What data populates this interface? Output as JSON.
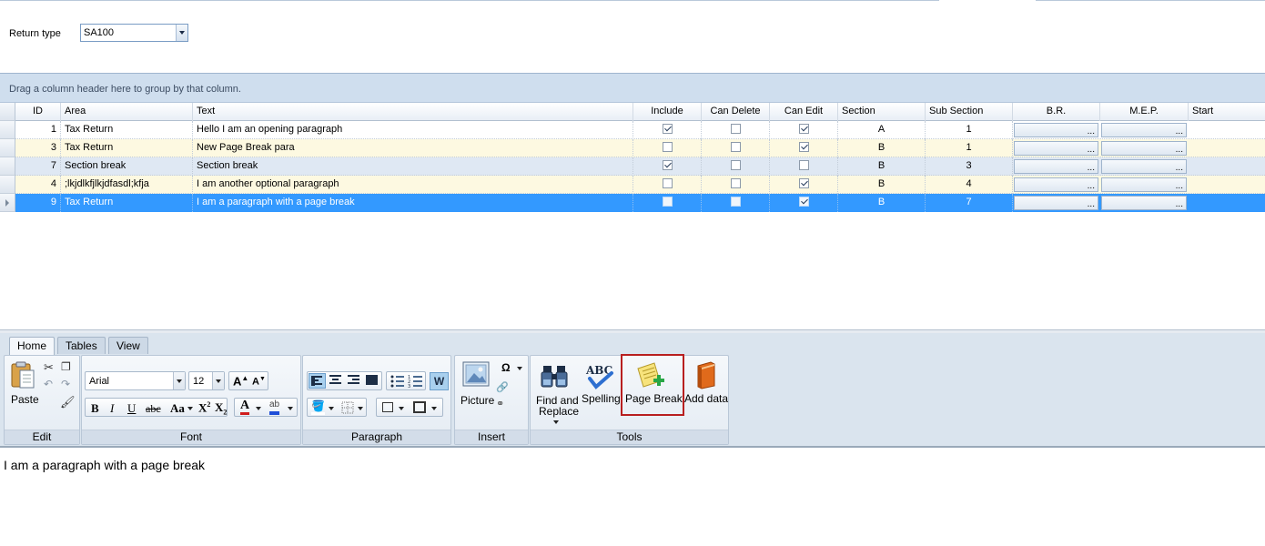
{
  "filter": {
    "label": "Return type",
    "value": "SA100"
  },
  "group_panel": {
    "text": "Drag a column header here to group by that column."
  },
  "grid": {
    "columns": [
      "ID",
      "Area",
      "Text",
      "Include",
      "Can Delete",
      "Can Edit",
      "Section",
      "Sub Section",
      "B.R.",
      "M.E.P.",
      "Start"
    ],
    "ellipsis": "...",
    "rows": [
      {
        "id": "1",
        "area": "Tax Return",
        "text": "Hello I am an opening paragraph",
        "include": true,
        "can_delete": false,
        "can_edit": true,
        "section": "A",
        "sub_section": "1"
      },
      {
        "id": "3",
        "area": "Tax Return",
        "text": "New Page Break para",
        "include": false,
        "can_delete": false,
        "can_edit": true,
        "section": "B",
        "sub_section": "1"
      },
      {
        "id": "7",
        "area": "Section break",
        "text": "Section break",
        "include": true,
        "can_delete": false,
        "can_edit": false,
        "section": "B",
        "sub_section": "3"
      },
      {
        "id": "4",
        "area": ";lkjdlkfjlkjdfasdl;kfja",
        "text": "I am another optional paragraph",
        "include": false,
        "can_delete": false,
        "can_edit": true,
        "section": "B",
        "sub_section": "4"
      },
      {
        "id": "9",
        "area": "Tax Return",
        "text": "I am a paragraph with a page break",
        "include": false,
        "can_delete": false,
        "can_edit": true,
        "section": "B",
        "sub_section": "7"
      }
    ]
  },
  "ribbon": {
    "tabs": [
      "Home",
      "Tables",
      "View"
    ],
    "active_tab": "Home",
    "groups": {
      "edit": {
        "label": "Edit",
        "paste": "Paste"
      },
      "font": {
        "label": "Font",
        "font_name": "Arial",
        "font_size": "12",
        "bold": "B",
        "italic": "I",
        "underline": "U",
        "strike": "abc",
        "change_case": "Aa"
      },
      "paragraph": {
        "label": "Paragraph"
      },
      "insert": {
        "label": "Insert",
        "picture": "Picture",
        "symbol": "Ω"
      },
      "tools": {
        "label": "Tools",
        "find_replace": "Find and Replace",
        "find_replace_line1": "Find and",
        "find_replace_line2": "Replace",
        "spelling": "Spelling",
        "page_break": "Page Break",
        "add_data": "Add data"
      }
    }
  },
  "editor": {
    "content": "I am a paragraph with a page break"
  },
  "colors": {
    "selection": "#3399ff",
    "row_alt": "#fdf9e1",
    "row_blue": "#dfe8f3",
    "highlight_box": "#b81f1f"
  }
}
